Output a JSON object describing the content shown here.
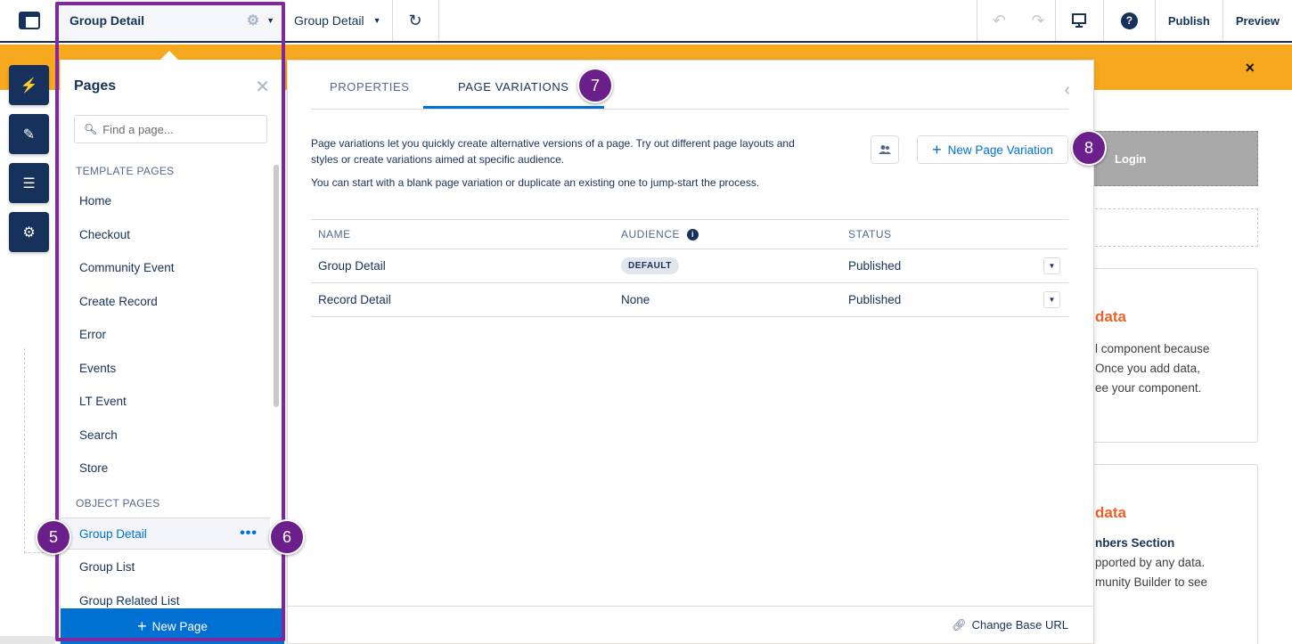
{
  "topbar": {
    "group_title": "Group Detail",
    "page_selector": "Group Detail",
    "publish_label": "Publish",
    "preview_label": "Preview",
    "help_label": "?"
  },
  "banner": {
    "close_label": "×"
  },
  "canvas": {
    "login_label": "Login",
    "card1": {
      "title": "data",
      "lines": [
        "l component because",
        "Once you add data,",
        "ee your component."
      ]
    },
    "card2": {
      "title": "data",
      "lines": [
        "nbers Section",
        "pported by any data.",
        "munity Builder to see"
      ]
    }
  },
  "pages_panel": {
    "title": "Pages",
    "search_placeholder": "Find a page...",
    "template_section": "TEMPLATE PAGES",
    "template_pages": [
      "Home",
      "Checkout",
      "Community Event",
      "Create Record",
      "Error",
      "Events",
      "LT Event",
      "Search",
      "Store"
    ],
    "object_section": "OBJECT PAGES",
    "object_pages": [
      "Group Detail",
      "Group List",
      "Group Related List"
    ],
    "selected_dots": "•••",
    "new_page_label": "New Page"
  },
  "main_panel": {
    "tabs": [
      "PROPERTIES",
      "PAGE VARIATIONS"
    ],
    "active_tab": "PAGE VARIATIONS",
    "description_line1": "Page variations let you quickly create alternative versions of a page. Try out different page layouts and",
    "description_line2": "styles or create variations aimed at specific audience.",
    "description_line3": "You can start with a blank page variation or duplicate an existing one to jump-start the process.",
    "new_variation_label": "New Page Variation",
    "table": {
      "headers": [
        "NAME",
        "AUDIENCE",
        "STATUS"
      ],
      "rows": [
        {
          "name": "Group Detail",
          "audience": "DEFAULT",
          "status": "Published"
        },
        {
          "name": "Record Detail",
          "audience": "None",
          "status": "Published"
        }
      ]
    },
    "change_base_url": "Change Base URL"
  },
  "callouts": [
    "5",
    "6",
    "7",
    "8"
  ],
  "colors": {
    "brand_navy": "#16325c",
    "accent_blue": "#0070d2",
    "banner_orange": "#f6a91e",
    "callout_purple": "#6b1f8b"
  }
}
